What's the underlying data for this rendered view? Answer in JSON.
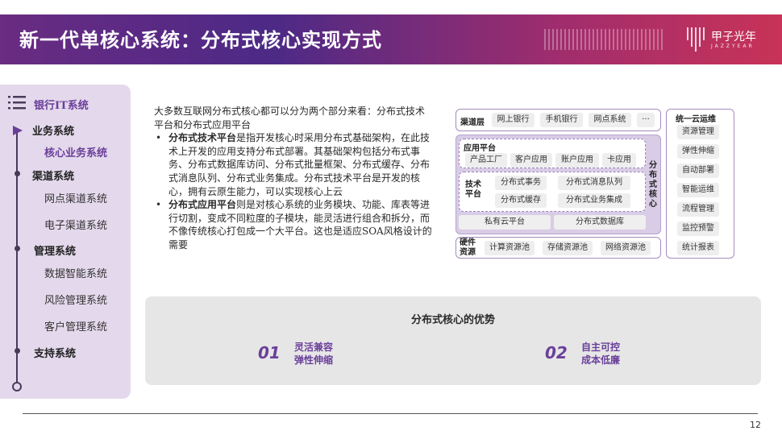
{
  "header": {
    "title": "新一代单核心系统：分布式核心实现方式",
    "logo_name": "甲子光年",
    "logo_sub": "JAZZYEAR"
  },
  "sidebar": {
    "heading": "银行IT系统",
    "items": [
      {
        "label": "业务系统"
      },
      {
        "label": "核心业务系统"
      },
      {
        "label": "渠道系统"
      },
      {
        "label": "网点渠道系统"
      },
      {
        "label": "电子渠道系统"
      },
      {
        "label": "管理系统"
      },
      {
        "label": "数据智能系统"
      },
      {
        "label": "风险管理系统"
      },
      {
        "label": "客户管理系统"
      },
      {
        "label": "支持系统"
      }
    ]
  },
  "intro": {
    "lead": "大多数互联网分布式核心都可以分为两个部分来看：分布式技术平台和分布式应用平台",
    "bullet1_bold": "分布式技术平台",
    "bullet1_text": "是指开发核心时采用分布式基础架构，在此技术上开发的应用支持分布式部署。其基础架构包括分布式事务、分布式数据库访问、分布式批量框架、分布式缓存、分布式消息队列、分布式业务集成。分布式技术平台是开发的核心，拥有云原生能力，可以实现核心上云",
    "bullet2_bold": "分布式应用平台",
    "bullet2_text": "则是对核心系统的业务模块、功能、库表等进行切割，变成不同粒度的子模块，能灵活进行组合和拆分，而不像传统核心打包成一个大平台。这也是适应SOA风格设计的需要"
  },
  "diagram": {
    "channel": {
      "label": "渠道层",
      "items": [
        "网上银行",
        "手机银行",
        "网点系统",
        "···"
      ]
    },
    "app_platform": {
      "label": "应用平台",
      "items": [
        "产品工厂",
        "客户应用",
        "账户应用",
        "卡应用"
      ]
    },
    "tech_platform": {
      "label": "技术平台",
      "items": [
        "分布式事务",
        "分布式消息队列",
        "分布式缓存",
        "分布式业务集成"
      ]
    },
    "bottom": [
      "私有云平台",
      "分布式数据库"
    ],
    "core_label": "分布式核心",
    "hardware": {
      "label": "硬件资源",
      "items": [
        "计算资源池",
        "存储资源池",
        "网络资源池"
      ]
    },
    "ops": {
      "title": "统一云运维",
      "items": [
        "资源管理",
        "弹性伸缩",
        "自动部署",
        "智能运维",
        "流程管理",
        "监控预警",
        "统计报表"
      ]
    }
  },
  "advantages": {
    "title": "分布式核心的优势",
    "items": [
      {
        "num": "01",
        "line1": "灵活兼容",
        "line2": "弹性伸缩"
      },
      {
        "num": "02",
        "line1": "自主可控",
        "line2": "成本低廉"
      }
    ]
  },
  "page_number": "12"
}
